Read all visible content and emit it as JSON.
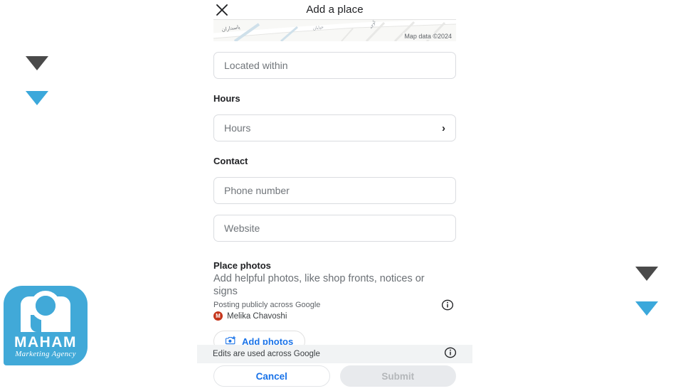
{
  "decor": {
    "marker_dark_color": "#4a4a4a",
    "marker_blue_color": "#3ba8db"
  },
  "logo": {
    "name": "MAHAM",
    "tagline": "Marketing Agency",
    "brand_color": "#41a9d8"
  },
  "topbar": {
    "close_label": "×",
    "title": "Add a place"
  },
  "map": {
    "attribution": "Map data ©2024"
  },
  "form": {
    "located_within": {
      "placeholder": "Located within",
      "value": ""
    },
    "hours_section_label": "Hours",
    "hours_field": {
      "placeholder": "Hours",
      "value": "",
      "chevron": "›"
    },
    "contact_section_label": "Contact",
    "phone": {
      "placeholder": "Phone number",
      "value": ""
    },
    "website": {
      "placeholder": "Website",
      "value": ""
    }
  },
  "place_photos": {
    "title": "Place photos",
    "description": "Add helpful photos, like shop fronts, notices or signs",
    "posting_note": "Posting publicly across Google",
    "author_initial": "M",
    "author_name": "Melika Chavoshi",
    "author_avatar_color": "#c5351b",
    "add_photos_label": "Add photos",
    "accent_color": "#1a73e8"
  },
  "footer": {
    "edits_note": "Edits are used across Google",
    "cancel_label": "Cancel",
    "submit_label": "Submit",
    "submit_disabled": true
  }
}
